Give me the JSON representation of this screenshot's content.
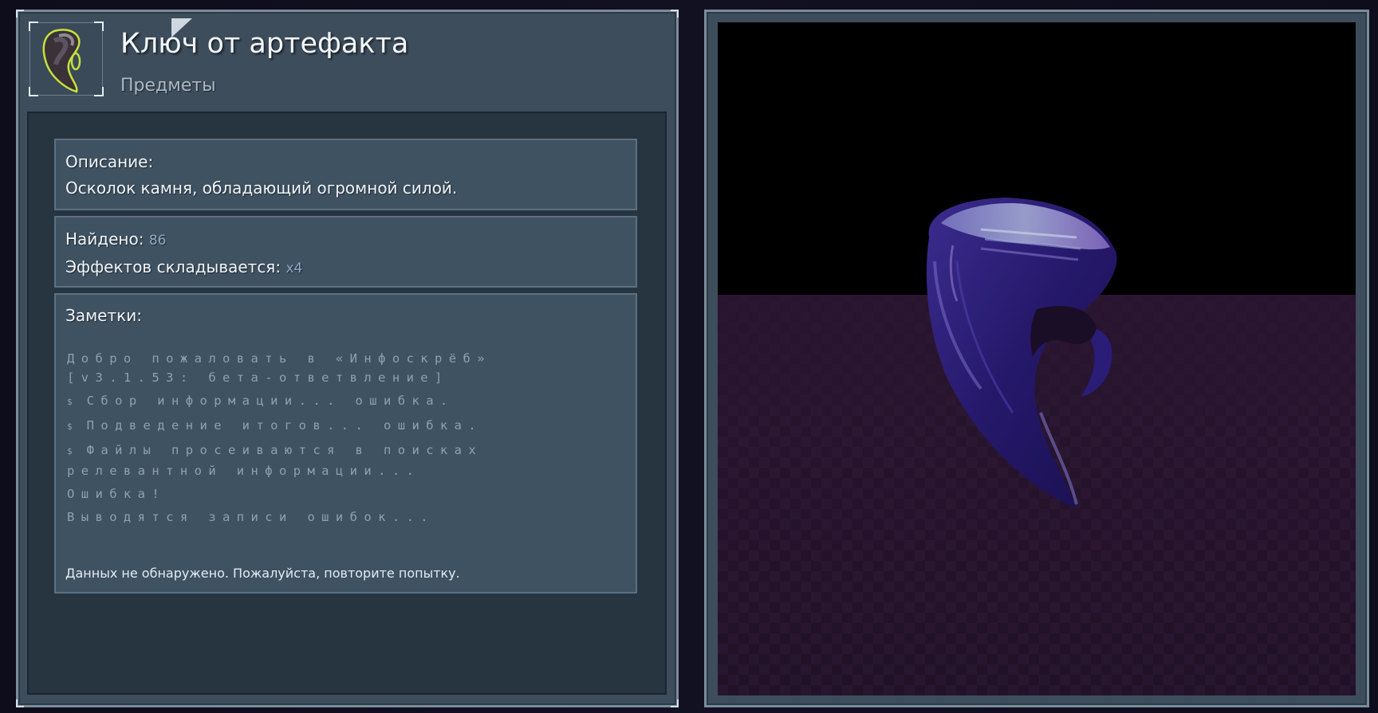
{
  "item": {
    "title": "Ключ от артефакта",
    "category": "Предметы",
    "icon": "artifact-key-icon"
  },
  "description": {
    "label": "Описание:",
    "text": "Осколок камня, обладающий огромной силой."
  },
  "stats": {
    "found_label": "Найдено:",
    "found_value": "86",
    "stack_label": "Эффектов складывается:",
    "stack_value": "x4"
  },
  "notes": {
    "label": "Заметки:",
    "lines": {
      "l0": "Добро пожаловать в «Инфоскрёб» [v3.1.53: бета-ответвление]",
      "l1": "Сбор информации... ошибка.",
      "l2": "Подведение итогов... ошибка.",
      "l3": "Файлы просеиваются в поисках релевантной информации...",
      "l4": "Ошибка!",
      "l5": "Выводятся записи ошибок..."
    },
    "prompt_symbol": "$",
    "footer": "Данных не обнаружено. Пожалуйста, повторите попытку."
  },
  "viewer": {
    "model": "artifact-key-model",
    "floor_color": "#2a1530",
    "model_color": "#4a2a8c"
  }
}
